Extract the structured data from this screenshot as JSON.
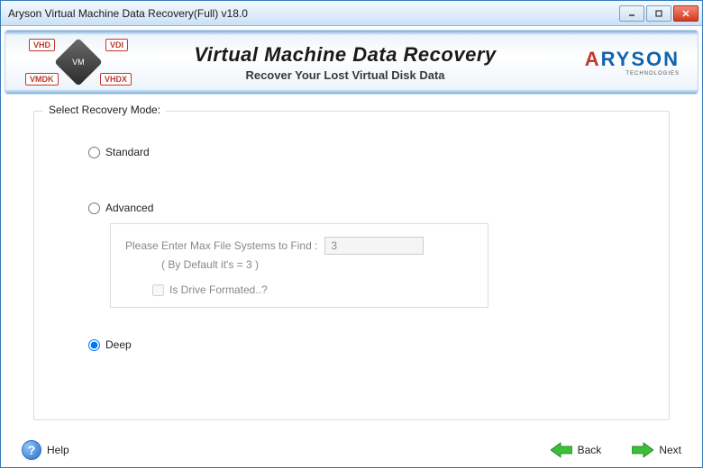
{
  "window": {
    "title": "Aryson Virtual Machine Data Recovery(Full) v18.0"
  },
  "banner": {
    "formats": {
      "vhd": "VHD",
      "vdi": "VDI",
      "vmdk": "VMDK",
      "vhdx": "VHDX"
    },
    "cube": "VM",
    "title": "Virtual Machine Data Recovery",
    "subtitle": "Recover Your Lost Virtual Disk Data",
    "brand": "ARYSON",
    "brand_sub": "TECHNOLOGIES"
  },
  "panel": {
    "legend": "Select Recovery Mode:",
    "options": {
      "standard": "Standard",
      "advanced": "Advanced",
      "deep": "Deep"
    },
    "selected": "deep",
    "advanced_sub": {
      "label": "Please Enter Max File Systems to Find :",
      "value": "3",
      "default_note": "( By Default  it's  = 3 )",
      "check_label": "Is Drive Formated..?"
    }
  },
  "footer": {
    "help": "Help",
    "back": "Back",
    "next": "Next"
  },
  "colors": {
    "arrow_green": "#3bbf3b"
  }
}
